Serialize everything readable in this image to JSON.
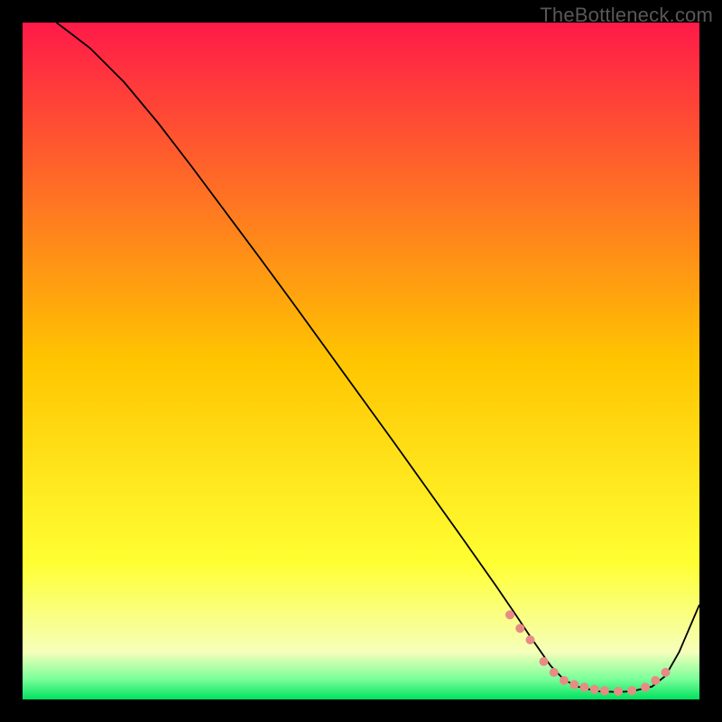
{
  "watermark": "TheBottleneck.com",
  "chart_data": {
    "type": "line",
    "title": "",
    "xlabel": "",
    "ylabel": "",
    "xlim": [
      0,
      100
    ],
    "ylim": [
      0,
      100
    ],
    "background": {
      "type": "vertical-gradient",
      "stops": [
        {
          "offset": 0.0,
          "color": "#ff1a49"
        },
        {
          "offset": 0.5,
          "color": "#ffc500"
        },
        {
          "offset": 0.8,
          "color": "#ffff33"
        },
        {
          "offset": 0.93,
          "color": "#f5ffba"
        },
        {
          "offset": 0.97,
          "color": "#7aff9a"
        },
        {
          "offset": 1.0,
          "color": "#00e15e"
        }
      ]
    },
    "series": [
      {
        "name": "curve",
        "color": "#000000",
        "width": 1.8,
        "x": [
          5,
          7,
          10,
          15,
          20,
          25,
          30,
          35,
          40,
          45,
          50,
          55,
          60,
          65,
          70,
          73,
          75,
          78,
          80,
          82,
          85,
          88,
          90,
          93,
          95,
          97,
          100
        ],
        "y": [
          100,
          98.5,
          96.2,
          91.2,
          85.2,
          78.7,
          72.0,
          65.3,
          58.5,
          51.6,
          44.7,
          37.8,
          30.8,
          23.8,
          16.7,
          12.3,
          9.3,
          5.0,
          2.9,
          1.9,
          1.2,
          1.1,
          1.2,
          1.9,
          3.5,
          7.0,
          14.0
        ]
      }
    ],
    "markers": {
      "name": "dots",
      "color": "#e88b85",
      "radius": 5,
      "x": [
        72,
        73.5,
        75,
        77,
        78.5,
        80,
        81.5,
        83,
        84.5,
        86,
        88,
        90,
        92,
        93.5,
        95
      ],
      "y": [
        12.5,
        10.5,
        8.8,
        5.6,
        4.0,
        2.8,
        2.2,
        1.8,
        1.5,
        1.3,
        1.2,
        1.3,
        1.8,
        2.8,
        4.0
      ]
    }
  }
}
